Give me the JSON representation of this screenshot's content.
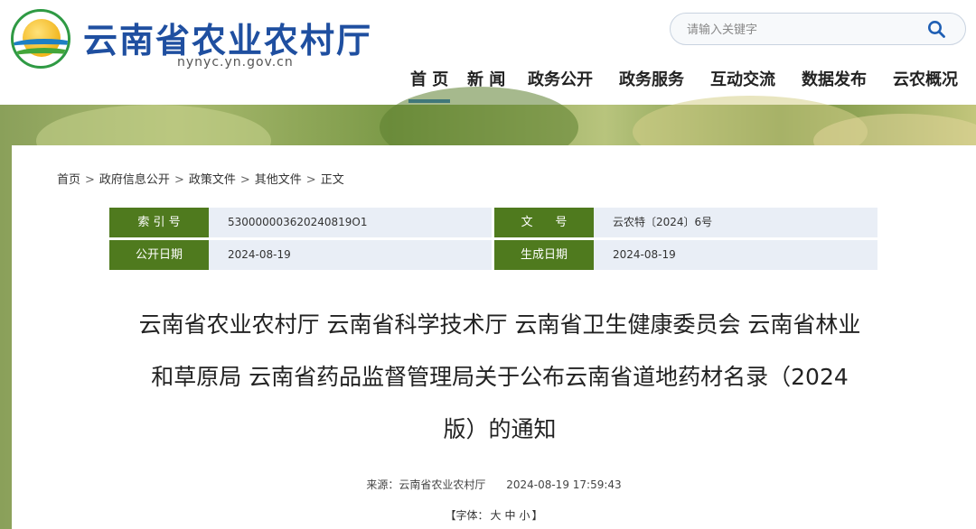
{
  "header": {
    "site_title": "云南省农业农村厅",
    "site_domain": "nynyc.yn.gov.cn",
    "search_placeholder": "请输入关键字"
  },
  "nav": {
    "items": [
      "首 页",
      "新 闻",
      "政务公开",
      "政务服务",
      "互动交流",
      "数据发布",
      "云农概况"
    ],
    "active_index": 0
  },
  "breadcrumb": {
    "items": [
      "首页",
      "政府信息公开",
      "政策文件",
      "其他文件",
      "正文"
    ],
    "separator": ">"
  },
  "meta": {
    "index_label": "索 引 号",
    "index_value": "530000003620240819O1",
    "doc_no_label": "文      号",
    "doc_no_value": "云农特〔2024〕6号",
    "publish_date_label": "公开日期",
    "publish_date_value": "2024-08-19",
    "created_date_label": "生成日期",
    "created_date_value": "2024-08-19"
  },
  "article": {
    "title_line1": "云南省农业农村厅 云南省科学技术厅 云南省卫生健康委员会 云南省林业",
    "title_line2": "和草原局 云南省药品监督管理局关于公布云南省道地药材名录（2024",
    "title_line3": "版）的通知",
    "source": "来源：云南省农业农村厅      2024-08-19 17:59:43",
    "font_label_open": "【字体：",
    "font_large": "大",
    "font_medium": "中",
    "font_small": "小",
    "font_label_close": "】"
  },
  "colors": {
    "brand_blue": "#1f4fa0",
    "nav_active": "#1f6ed4",
    "meta_label_bg": "#4f7a1e",
    "meta_value_bg": "#e9eef6"
  }
}
